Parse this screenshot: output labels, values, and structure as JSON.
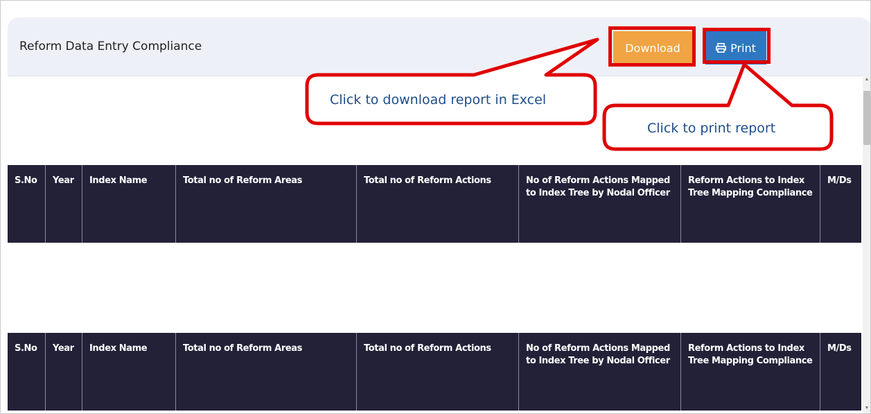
{
  "page": {
    "title": "Reform Data Entry Compliance"
  },
  "toolbar": {
    "download_label": "Download",
    "print_label": "Print"
  },
  "annotations": {
    "download_hint": "Click to download  report  in Excel",
    "print_hint": "Click to print  report"
  },
  "table": {
    "headers": [
      "S.No",
      "Year",
      "Index Name",
      "Total no of Reform Areas",
      "Total no of Reform Actions",
      "No of Reform Actions Mapped to Index Tree by Nodal Officer",
      "Reform Actions to Index Tree Mapping Compliance",
      "M/Ds"
    ]
  },
  "colors": {
    "header_bg": "#232138",
    "download_btn": "#f0a443",
    "print_btn": "#2e78c2",
    "highlight": "#e00000",
    "callout_text": "#1f4d8a"
  }
}
